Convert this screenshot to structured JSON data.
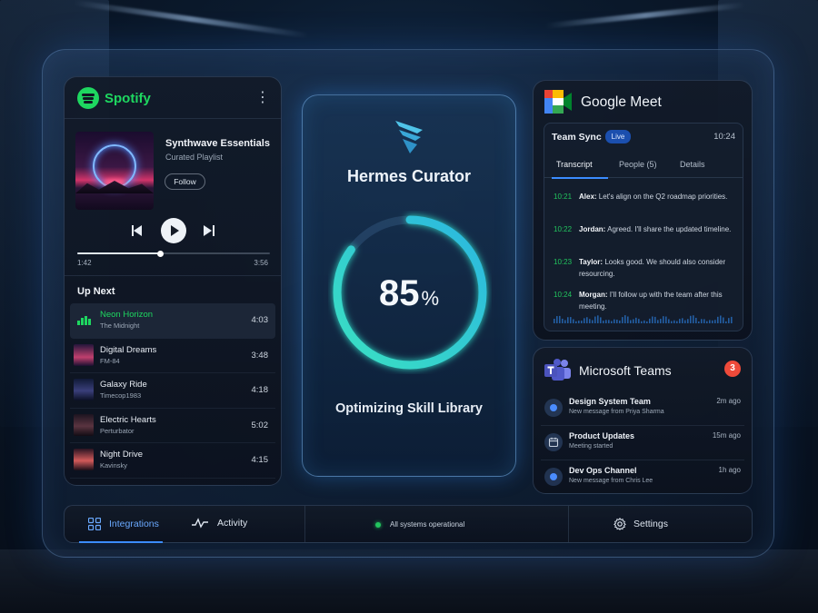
{
  "spotify": {
    "brand": "Spotify",
    "playlist_title": "Synthwave Essentials",
    "playlist_subtitle": "Curated Playlist",
    "follow_label": "Follow",
    "progress": {
      "elapsed": "1:42",
      "total": "3:56",
      "fraction": 0.43
    },
    "up_next_label": "Up Next",
    "queue": [
      {
        "title": "Neon Horizon",
        "artist": "The Midnight",
        "duration": "4:03",
        "playing": true
      },
      {
        "title": "Digital Dreams",
        "artist": "FM-84",
        "duration": "3:48"
      },
      {
        "title": "Galaxy Ride",
        "artist": "Timecop1983",
        "duration": "4:18"
      },
      {
        "title": "Electric Hearts",
        "artist": "Perturbator",
        "duration": "5:02"
      },
      {
        "title": "Night Drive",
        "artist": "Kavinsky",
        "duration": "4:15"
      }
    ]
  },
  "hermes": {
    "title": "Hermes Curator",
    "progress_value": "85",
    "progress_unit": "%",
    "progress_fraction": 0.85,
    "status": "Optimizing Skill Library"
  },
  "meet": {
    "brand": "Google Meet",
    "meeting_title": "Team Sync",
    "live_label": "Live",
    "time": "10:24",
    "tabs": [
      "Transcript",
      "People (5)",
      "Details"
    ],
    "transcript": [
      {
        "time": "10:21",
        "speaker": "Alex:",
        "text": "Let's align on the Q2 roadmap priorities."
      },
      {
        "time": "10:22",
        "speaker": "Jordan:",
        "text": "Agreed. I'll share the updated timeline."
      },
      {
        "time": "10:23",
        "speaker": "Taylor:",
        "text": "Looks good. We should also consider resourcing."
      },
      {
        "time": "10:24",
        "speaker": "Morgan:",
        "text": "I'll follow up with the team after this meeting."
      }
    ]
  },
  "teams": {
    "brand": "Microsoft Teams",
    "badge_count": "3",
    "items": [
      {
        "title": "Design System Team",
        "subtitle": "New message from Priya Sharma",
        "time": "2m ago",
        "icon": "message-dot-icon"
      },
      {
        "title": "Product Updates",
        "subtitle": "Meeting started",
        "time": "15m ago",
        "icon": "calendar-icon"
      },
      {
        "title": "Dev Ops Channel",
        "subtitle": "New message from Chris Lee",
        "time": "1h ago",
        "icon": "message-dot-icon"
      }
    ]
  },
  "bottom_bar": {
    "integrations_label": "Integrations",
    "activity_label": "Activity",
    "status_text": "All systems operational",
    "settings_label": "Settings"
  },
  "colors": {
    "spotify_green": "#1ed760",
    "accent_blue": "#3b8cff",
    "ring_teal": "#2fd6c4",
    "live_badge": "#1b4fae",
    "notification_red": "#ef4a3a"
  }
}
